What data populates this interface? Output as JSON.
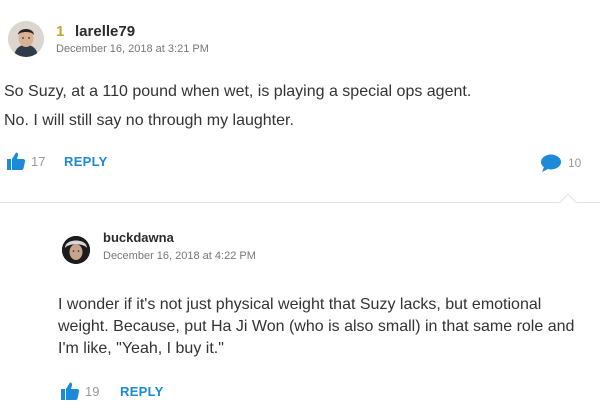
{
  "comment": {
    "rank": "1",
    "username": "larelle79",
    "date": "December 16, 2018 at 3:21 PM",
    "paragraphs": [
      "So Suzy, at a 110 pound when wet, is playing a special ops agent.",
      "No. I will still say no through my laughter."
    ],
    "likes": "17",
    "reply_label": "REPLY",
    "reply_count": "10"
  },
  "reply": {
    "username": "buckdawna",
    "date": "December 16, 2018 at 4:22 PM",
    "text": "I wonder if it's not just physical weight that Suzy lacks, but emotional weight. Because, put Ha Ji Won (who is also small) in that same role and I'm like, \"Yeah, I buy it.\"",
    "likes": "19",
    "reply_label": "REPLY"
  },
  "colors": {
    "accent": "#1c8ad8",
    "rank": "#c9a227",
    "muted": "#9a9a9a"
  }
}
